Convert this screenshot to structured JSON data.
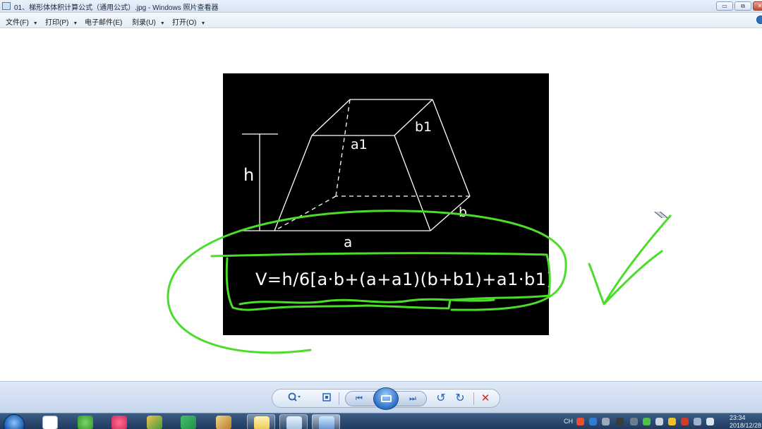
{
  "window": {
    "title": "01、梯形体体积计算公式（通用公式）.jpg - Windows 照片查看器",
    "minimize_glyph": "▭",
    "restore_glyph": "⧉",
    "close_glyph": "✕"
  },
  "menu": {
    "items": [
      {
        "label": "文件(F)"
      },
      {
        "label": "打印(P)"
      },
      {
        "label": "电子邮件(E)"
      },
      {
        "label": "刻录(U)"
      },
      {
        "label": "打开(O)"
      }
    ],
    "caret": "▼"
  },
  "image": {
    "labels": {
      "b1": "b1",
      "a1": "a1",
      "h": "h",
      "b": "b",
      "a": "a"
    },
    "formula": "V=h/6[a·b+(a+a1)(b+b1)+a1·b1]",
    "annotation_color": "#4cdc2a"
  },
  "controls": {
    "zoom_icon": "magnifier-icon",
    "fit_icon": "fit-window-icon",
    "prev_glyph": "⏮",
    "next_glyph": "⏭",
    "rotate_ccw_glyph": "↺",
    "rotate_cw_glyph": "↻",
    "delete_glyph": "✕"
  },
  "taskbar": {
    "language": "CH",
    "time": "23:34",
    "date": "2018/12/28"
  }
}
